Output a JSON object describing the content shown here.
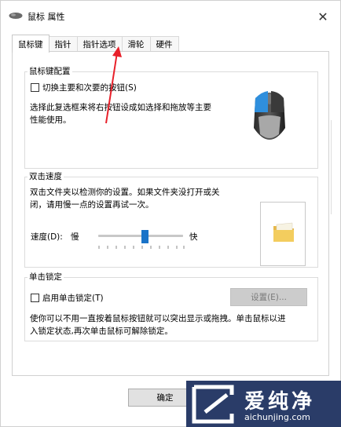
{
  "window": {
    "title": "鼠标 属性",
    "close_label": "✕"
  },
  "tabs": [
    {
      "label": "鼠标键",
      "active": true
    },
    {
      "label": "指针",
      "active": false
    },
    {
      "label": "指针选项",
      "active": false
    },
    {
      "label": "滑轮",
      "active": false
    },
    {
      "label": "硬件",
      "active": false
    }
  ],
  "button_config": {
    "group_label": "鼠标键配置",
    "switch_checkbox_label": "切换主要和次要的按钮(S)",
    "switch_checked": false,
    "description_line1": "选择此复选框来将右按钮设成如选择和拖放等主要",
    "description_line2": "性能使用。"
  },
  "double_click": {
    "group_label": "双击速度",
    "description_line1": "双击文件夹以检测你的设置。如果文件夹没打开或关",
    "description_line2": "闭，请用慢一点的设置再试一次。",
    "speed_label": "速度(D):",
    "slow_label": "慢",
    "fast_label": "快",
    "speed_value": 0.55
  },
  "click_lock": {
    "group_label": "单击锁定",
    "checkbox_label": "启用单击锁定(T)",
    "checked": false,
    "settings_button": "设置(E)...",
    "description_line1": "使你可以不用一直按着鼠标按钮就可以突出显示或拖拽。单击鼠标以进",
    "description_line2": "入锁定状态,再次单击鼠标可解除锁定。"
  },
  "footer": {
    "ok_button": "确定"
  },
  "watermark": {
    "title": "爱纯净",
    "url": "aichunjing.com"
  },
  "colors": {
    "accent": "#1a73c8",
    "annotation_arrow": "#e8202a",
    "watermark_bg": "#2a3c68"
  }
}
